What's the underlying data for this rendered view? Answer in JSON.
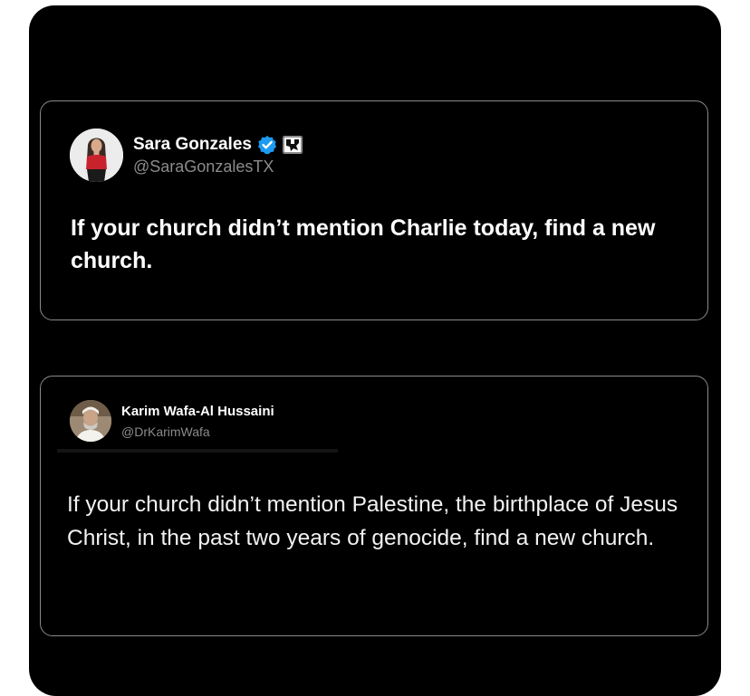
{
  "tweets": [
    {
      "name": "Sara Gonzales",
      "handle": "@SaraGonzalesTX",
      "verified": true,
      "text": "If your church didn’t mention Charlie today, find a new church."
    },
    {
      "name": "Karim Wafa-Al Hussaini",
      "handle": "@DrKarimWafa",
      "verified": false,
      "text": "If your church didn’t mention Palestine, the birthplace of Jesus Christ, in the past two years of genocide, find a new church."
    }
  ],
  "icons": {
    "verified": "verified-badge-icon",
    "affiliate": "affiliate-badge-icon"
  },
  "colors": {
    "background": "#000000",
    "card_border": "#8a8a8a",
    "text": "#ffffff",
    "handle": "#8b8b8b",
    "verified": "#1d9bf0"
  }
}
